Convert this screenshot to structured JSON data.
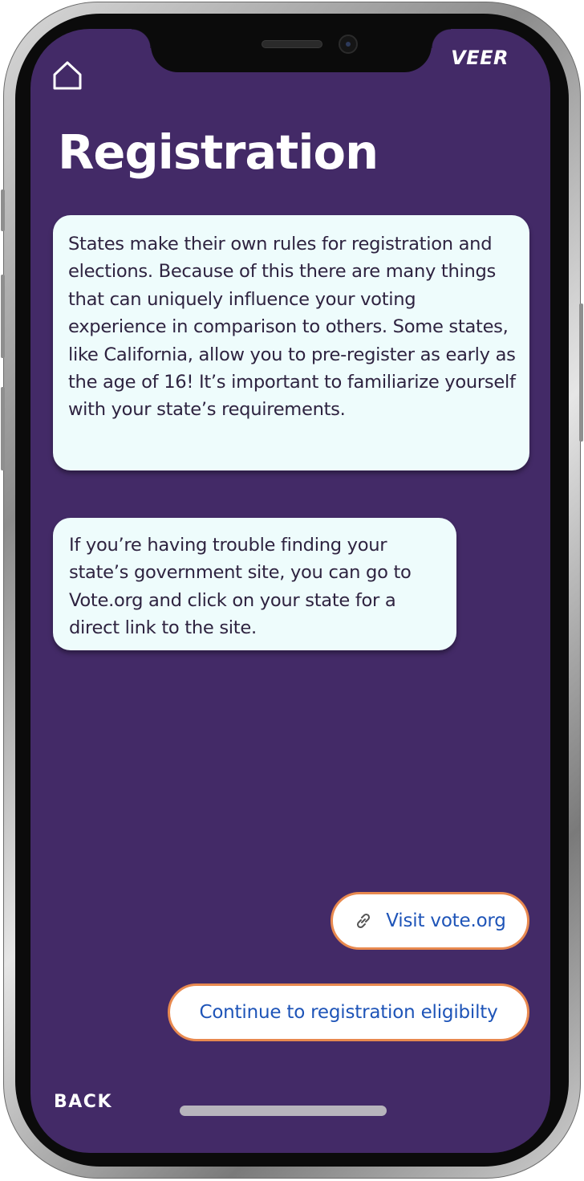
{
  "app": {
    "brand": "VEER",
    "accent_color": "#432a67",
    "bubble_color": "#eefcfc",
    "button_border_color": "#e8894f",
    "button_text_color": "#1e54b8"
  },
  "header": {
    "home_icon": "home-icon",
    "title": "Registration"
  },
  "messages": [
    {
      "text": "States make their own rules for registration and elections. Because of this there are many things that can uniquely influence your voting experience in comparison to others. Some states, like California, allow you to pre-register as early as the age of 16! It’s important to familiarize yourself with your state’s requirements."
    },
    {
      "text": "If you’re having trouble finding your state’s government site, you can go to Vote.org and click on your state for a direct link to the site."
    }
  ],
  "actions": {
    "visit_icon": "link-icon",
    "visit_label": "Visit vote.org",
    "continue_label": "Continue to registration eligibilty"
  },
  "footer": {
    "back_label": "BACK"
  }
}
